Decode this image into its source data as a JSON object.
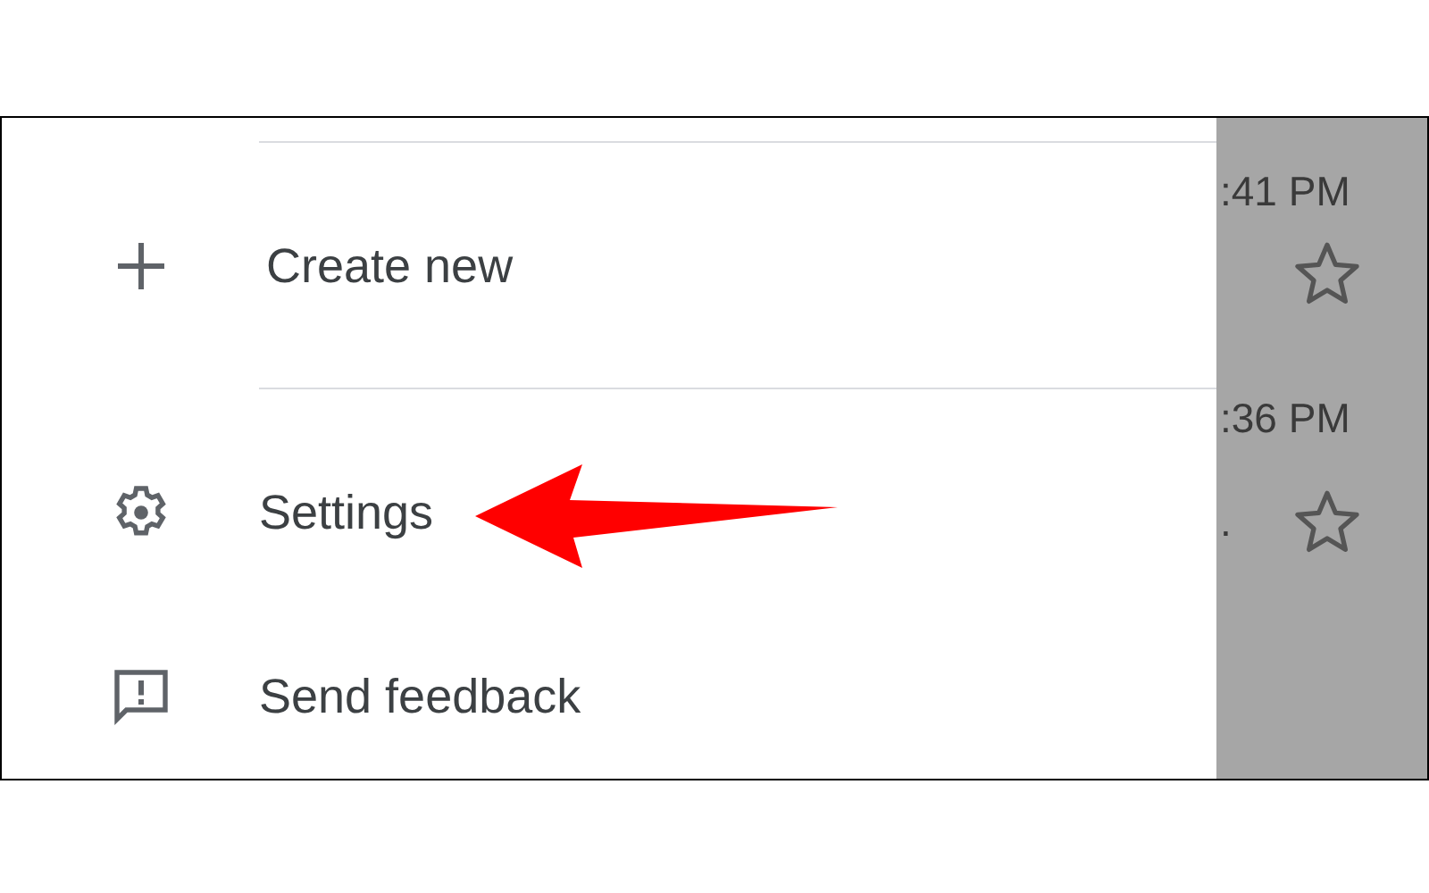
{
  "drawer": {
    "items": [
      {
        "label": "Create new",
        "kind": "plus",
        "divider_above": true
      },
      {
        "label": "Settings",
        "kind": "gear",
        "divider_above": true
      },
      {
        "label": "Send feedback",
        "kind": "feedback",
        "divider_above": false
      }
    ]
  },
  "background_list": {
    "rows": [
      {
        "time": ":41 PM",
        "starred": false
      },
      {
        "time": ":36 PM",
        "snippet": ".",
        "starred": false
      }
    ]
  }
}
